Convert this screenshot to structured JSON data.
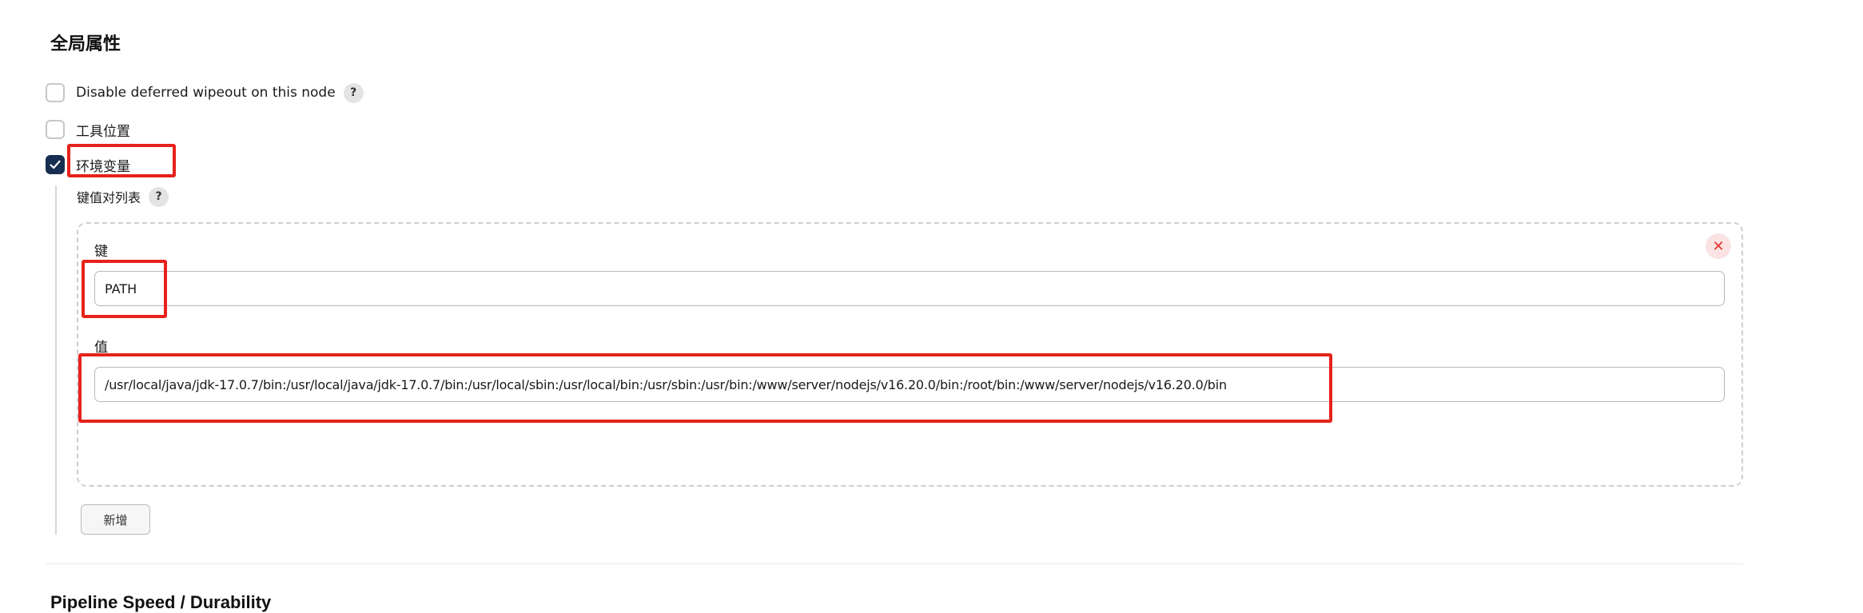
{
  "sections": {
    "global_properties_title": "全局属性",
    "pipeline_title": "Pipeline Speed / Durability"
  },
  "options": {
    "disable_wipeout": {
      "label": "Disable deferred wipeout on this node",
      "checked": false,
      "help": "?"
    },
    "tool_locations": {
      "label": "工具位置",
      "checked": false
    },
    "env_vars": {
      "label": "环境变量",
      "checked": true
    }
  },
  "kv_list": {
    "title": "键值对列表",
    "help": "?",
    "key_label": "键",
    "value_label": "值",
    "entries": [
      {
        "key": "PATH",
        "value": "/usr/local/java/jdk-17.0.7/bin:/usr/local/java/jdk-17.0.7/bin:/usr/local/sbin:/usr/local/bin:/usr/sbin:/usr/bin:/www/server/nodejs/v16.20.0/bin:/root/bin:/www/server/nodejs/v16.20.0/bin"
      }
    ],
    "delete_symbol": "✕",
    "add_button": "新增"
  },
  "icons": {
    "check": "checkmark-icon",
    "delete": "close-icon",
    "help": "question-icon"
  },
  "colors": {
    "checkbox_checked": "#162e51",
    "annotation": "#e6221b",
    "delete_icon": "#e0332f"
  }
}
